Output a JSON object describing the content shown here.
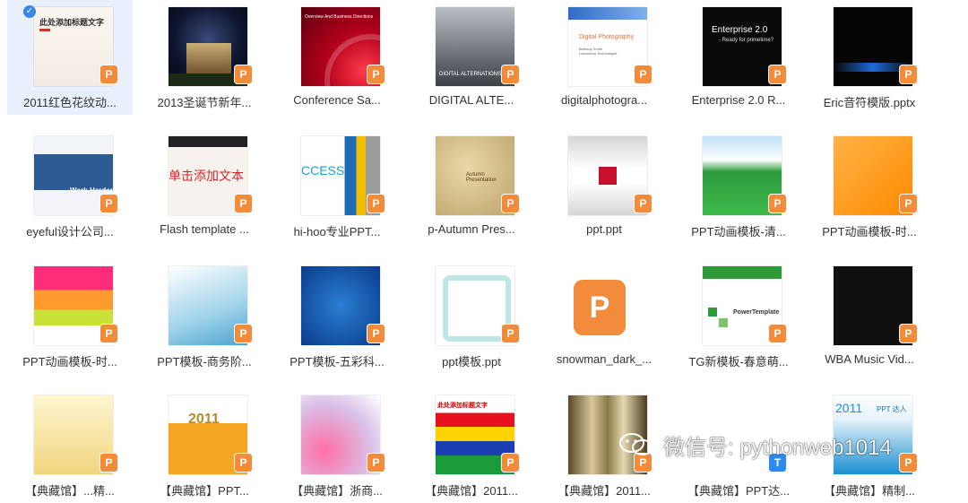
{
  "files": [
    {
      "label": "2011红色花纹动...",
      "badge": "P",
      "thumb_title": "此处添加标题文字",
      "selected": true
    },
    {
      "label": "2013圣诞节新年...",
      "badge": "P"
    },
    {
      "label": "Conference Sa...",
      "badge": "P",
      "thumb_title": "Overview And Business Directions"
    },
    {
      "label": "DIGITAL    ALTE...",
      "badge": "P",
      "thumb_title": "DIGITAL ALTERNATIONS"
    },
    {
      "label": "digitalphotogra...",
      "badge": "P",
      "thumb_title": "Digital Photography",
      "thumb_sub": "Bethany Smith\nLaboratory Technologist"
    },
    {
      "label": "Enterprise 2.0 R...",
      "badge": "P",
      "thumb_title": "Enterprise 2.0",
      "thumb_sub": "- Ready for primetime?"
    },
    {
      "label": "Eric音符模版.pptx",
      "badge": "P"
    },
    {
      "label": "eyeful设计公司...",
      "badge": "P",
      "thumb_title": "Work Harder"
    },
    {
      "label": "Flash template ...",
      "badge": "P",
      "thumb_title": "单击添加文本"
    },
    {
      "label": "hi-hoo专业PPT...",
      "badge": "P",
      "thumb_title": "CCESS"
    },
    {
      "label": "p-Autumn Pres...",
      "badge": "P",
      "thumb_title": "Autumn Presentation"
    },
    {
      "label": "ppt.ppt",
      "badge": "P"
    },
    {
      "label": "PPT动画模板-清...",
      "badge": "P"
    },
    {
      "label": "PPT动画模板-时...",
      "badge": "P"
    },
    {
      "label": "PPT动画模板-时...",
      "badge": "P"
    },
    {
      "label": "PPT模板-商务阶...",
      "badge": "P"
    },
    {
      "label": "PPT模板-五彩科...",
      "badge": "P"
    },
    {
      "label": "ppt模板.ppt",
      "badge": "P"
    },
    {
      "label": "snowman_dark_...",
      "badge": "P"
    },
    {
      "label": "TG新模板-春意萌...",
      "badge": "P",
      "thumb_title": "PowerTemplate"
    },
    {
      "label": "WBA Music Vid...",
      "badge": "P"
    },
    {
      "label": "【典藏馆】...精...",
      "badge": "P"
    },
    {
      "label": "【典藏馆】PPT...",
      "badge": "P",
      "thumb_title": "2011"
    },
    {
      "label": "【典藏馆】浙商...",
      "badge": "P"
    },
    {
      "label": "【典藏馆】2011...",
      "badge": "P",
      "thumb_title": "此处添加标题文字"
    },
    {
      "label": "【典藏馆】2011...",
      "badge": "P"
    },
    {
      "label": "【典藏馆】PPT达...",
      "badge": "T"
    },
    {
      "label": "【典藏馆】精制...",
      "badge": "P",
      "thumb_title": "2011",
      "thumb_sub": "PPT 达人"
    }
  ],
  "big_icon_glyph": "P",
  "watermark": {
    "text": "微信号: pythonweb1014"
  },
  "colors": {
    "wps_orange": "#f28b3a",
    "selection": "#e8f1fb",
    "check_blue": "#3a86e8",
    "wps_blue": "#2d8bf0"
  },
  "icons": {
    "check": "checkmark-icon",
    "watermark": "wechat-icon",
    "badge": "wps-presentation-icon"
  }
}
